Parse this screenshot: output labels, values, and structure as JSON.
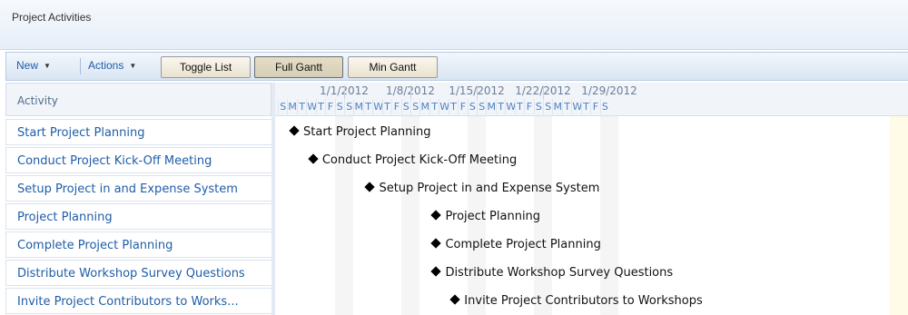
{
  "list": {
    "title": "Project Activities"
  },
  "toolbar": {
    "new_label": "New",
    "actions_label": "Actions",
    "toggle_list_label": "Toggle List",
    "full_gantt_label": "Full Gantt",
    "min_gantt_label": "Min Gantt"
  },
  "grid": {
    "activity_header": "Activity",
    "rows": [
      {
        "label": "Start Project Planning"
      },
      {
        "label": "Conduct Project Kick-Off Meeting"
      },
      {
        "label": "Setup Project in and Expense System"
      },
      {
        "label": "Project Planning"
      },
      {
        "label": "Complete Project Planning"
      },
      {
        "label": "Distribute Workshop Survey Questions"
      },
      {
        "label": "Invite Project Contributors to Works..."
      }
    ]
  },
  "gantt": {
    "weeks": [
      "1/1/2012",
      "1/8/2012",
      "1/15/2012",
      "1/22/2012",
      "1/29/2012"
    ],
    "day_letters": [
      "S",
      "M",
      "T",
      "W",
      "T",
      "F",
      "S"
    ],
    "tasks": [
      {
        "label": "Start Project Planning",
        "date": "1/1/2012"
      },
      {
        "label": "Conduct Project Kick-Off Meeting",
        "date": "1/3/2012"
      },
      {
        "label": "Setup Project in and Expense System",
        "date": "1/9/2012"
      },
      {
        "label": "Project Planning",
        "date": "1/16/2012"
      },
      {
        "label": "Complete Project Planning",
        "date": "1/16/2012"
      },
      {
        "label": "Distribute Workshop Survey Questions",
        "date": "1/16/2012"
      },
      {
        "label": "Invite Project Contributors to Workshops",
        "date": "1/18/2012"
      }
    ]
  }
}
